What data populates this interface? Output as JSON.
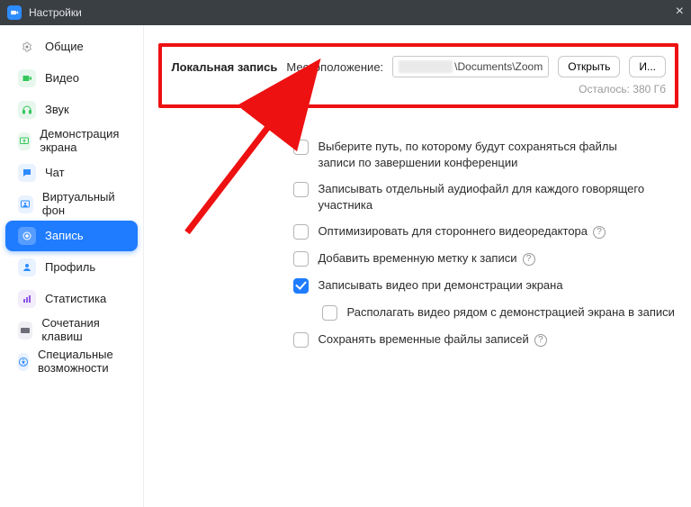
{
  "window": {
    "title": "Настройки"
  },
  "sidebar": {
    "items": [
      {
        "label": "Общие",
        "color": "#e9e9e9",
        "iconFill": "#8f8f8f"
      },
      {
        "label": "Видео",
        "color": "#e8f7ee",
        "iconFill": "#34c759"
      },
      {
        "label": "Звук",
        "color": "#e8f7ee",
        "iconFill": "#34c759"
      },
      {
        "label": "Демонстрация экрана",
        "color": "#e8f7ee",
        "iconFill": "#34c759"
      },
      {
        "label": "Чат",
        "color": "#e9f2ff",
        "iconFill": "#2D8CFF"
      },
      {
        "label": "Виртуальный фон",
        "color": "#e9f2ff",
        "iconFill": "#2D8CFF"
      },
      {
        "label": "Запись",
        "color": "#ffffff",
        "iconFill": "#ffffff"
      },
      {
        "label": "Профиль",
        "color": "#e9f2ff",
        "iconFill": "#2D8CFF"
      },
      {
        "label": "Статистика",
        "color": "#f2ecfb",
        "iconFill": "#8e55e9"
      },
      {
        "label": "Сочетания клавиш",
        "color": "#efeff4",
        "iconFill": "#6e6e78"
      },
      {
        "label": "Специальные возможности",
        "color": "#e9f2ff",
        "iconFill": "#2D8CFF"
      }
    ]
  },
  "local": {
    "section_title": "Локальная запись",
    "location_label": "Местоположение:",
    "path_visible": "\\Documents\\Zoom",
    "open_btn": "Открыть",
    "change_btn": "И...",
    "remaining": "Осталось: 380 Гб"
  },
  "options": [
    {
      "label": "Выберите путь, по которому будут сохраняться файлы записи по завершении конференции",
      "checked": false
    },
    {
      "label": "Записывать отдельный аудиофайл для каждого говорящего участника",
      "checked": false
    },
    {
      "label": "Оптимизировать для стороннего видеоредактора",
      "checked": false,
      "help": true
    },
    {
      "label": "Добавить временную метку к записи",
      "checked": false,
      "help": true
    },
    {
      "label": "Записывать видео при демонстрации экрана",
      "checked": true
    },
    {
      "label": "Располагать видео рядом с демонстрацией экрана в записи",
      "checked": false,
      "indent": true
    },
    {
      "label": "Сохранять временные файлы записей",
      "checked": false,
      "help": true
    }
  ],
  "colors": {
    "accent": "#1f7cff",
    "highlight": "#e11"
  }
}
